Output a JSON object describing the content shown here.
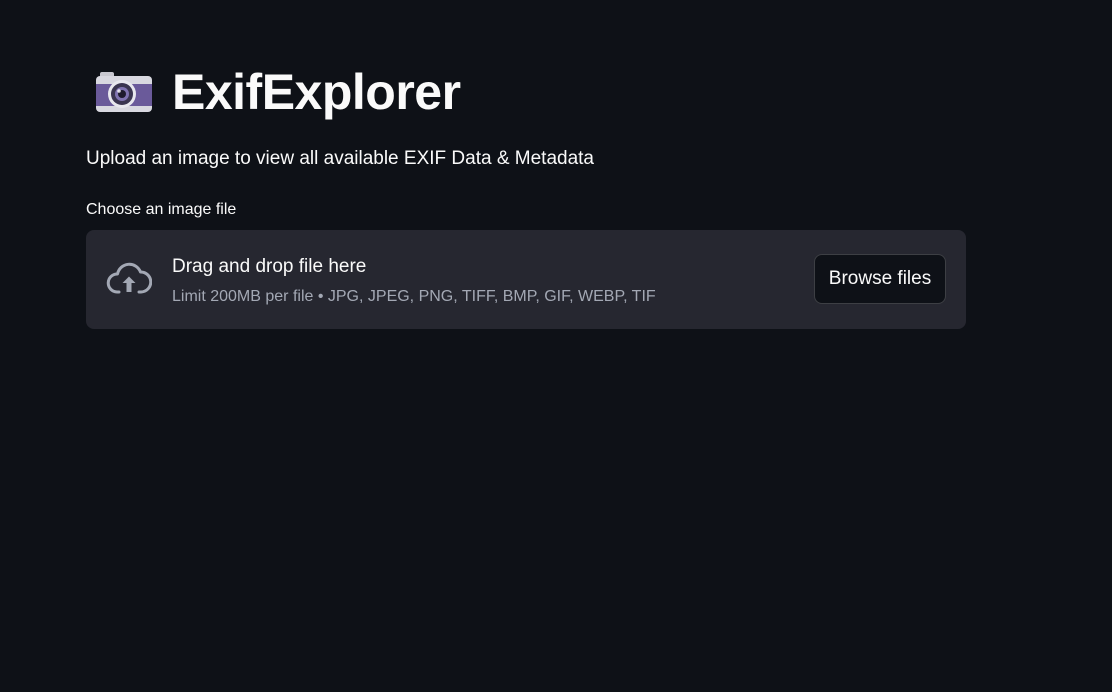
{
  "header": {
    "icon": "camera-icon",
    "title": "ExifExplorer"
  },
  "subtitle": "Upload an image to view all available EXIF Data & Metadata",
  "uploader": {
    "label": "Choose an image file",
    "icon": "cloud-upload-icon",
    "drag_text": "Drag and drop file here",
    "limit_text": "Limit 200MB per file • JPG, JPEG, PNG, TIFF, BMP, GIF, WEBP, TIF",
    "button_label": "Browse files"
  },
  "colors": {
    "background": "#0e1117",
    "dropzone": "#262730",
    "text": "#fafafa",
    "muted_text": "#a3a8b4"
  }
}
